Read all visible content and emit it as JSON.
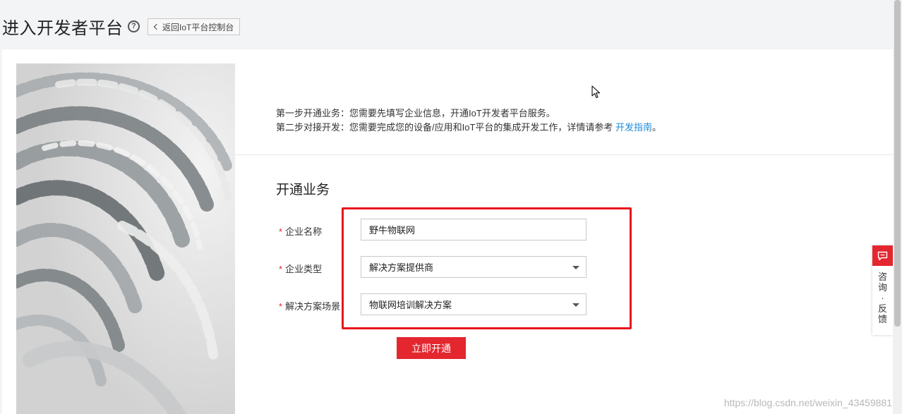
{
  "header": {
    "title": "进入开发者平台",
    "help_symbol": "?",
    "back_label": "返回IoT平台控制台"
  },
  "intro": {
    "step1": "第一步开通业务：您需要先填写企业信息，开通IoT开发者平台服务。",
    "step2_prefix": "第二步对接开发：您需要完成您的设备/应用和IoT平台的集成开发工作，详情请参考 ",
    "step2_link": "开发指南",
    "step2_suffix": "。"
  },
  "form": {
    "section_title": "开通业务",
    "required_mark": "*",
    "company_name_label": "企业名称",
    "company_name_value": "野牛物联网",
    "company_type_label": "企业类型",
    "company_type_value": "解决方案提供商",
    "scenario_label": "解决方案场景",
    "scenario_value": "物联网培训解决方案",
    "submit_label": "立即开通"
  },
  "feedback": {
    "label": "咨询·反馈"
  },
  "watermark": "https://blog.csdn.net/weixin_43459881",
  "colors": {
    "accent": "#e4262f",
    "link": "#1e8ad6",
    "highlight": "#e8141d"
  },
  "icons": {
    "help": "help-circle-icon",
    "back": "chevron-left-icon",
    "dropdown": "caret-down-icon",
    "feedback": "chat-bubble-icon",
    "cursor": "mouse-pointer-icon"
  }
}
